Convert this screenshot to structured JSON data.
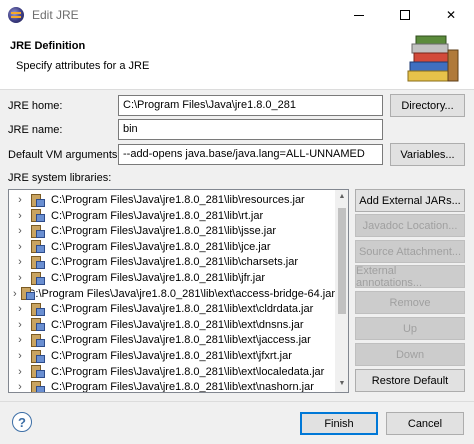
{
  "window": {
    "title": "Edit JRE"
  },
  "banner": {
    "title": "JRE Definition",
    "subtitle": "Specify attributes for a JRE"
  },
  "form": {
    "jre_home_label": "JRE home:",
    "jre_home_value": "C:\\Program Files\\Java\\jre1.8.0_281",
    "directory_button": "Directory...",
    "jre_name_label": "JRE name:",
    "jre_name_value": "bin",
    "vm_args_label": "Default VM arguments:",
    "vm_args_value": "--add-opens java.base/java.lang=ALL-UNNAMED",
    "variables_button": "Variables..."
  },
  "libraries": {
    "label": "JRE system libraries:",
    "items": [
      "C:\\Program Files\\Java\\jre1.8.0_281\\lib\\resources.jar",
      "C:\\Program Files\\Java\\jre1.8.0_281\\lib\\rt.jar",
      "C:\\Program Files\\Java\\jre1.8.0_281\\lib\\jsse.jar",
      "C:\\Program Files\\Java\\jre1.8.0_281\\lib\\jce.jar",
      "C:\\Program Files\\Java\\jre1.8.0_281\\lib\\charsets.jar",
      "C:\\Program Files\\Java\\jre1.8.0_281\\lib\\jfr.jar",
      "C:\\Program Files\\Java\\jre1.8.0_281\\lib\\ext\\access-bridge-64.jar",
      "C:\\Program Files\\Java\\jre1.8.0_281\\lib\\ext\\cldrdata.jar",
      "C:\\Program Files\\Java\\jre1.8.0_281\\lib\\ext\\dnsns.jar",
      "C:\\Program Files\\Java\\jre1.8.0_281\\lib\\ext\\jaccess.jar",
      "C:\\Program Files\\Java\\jre1.8.0_281\\lib\\ext\\jfxrt.jar",
      "C:\\Program Files\\Java\\jre1.8.0_281\\lib\\ext\\localedata.jar",
      "C:\\Program Files\\Java\\jre1.8.0_281\\lib\\ext\\nashorn.jar"
    ],
    "buttons": {
      "add_external": "Add External JARs...",
      "javadoc": "Javadoc Location...",
      "source": "Source Attachment...",
      "external_annotations": "External annotations...",
      "remove": "Remove",
      "up": "Up",
      "down": "Down",
      "restore": "Restore Default"
    }
  },
  "footer": {
    "help_glyph": "?",
    "finish": "Finish",
    "cancel": "Cancel"
  },
  "icons": {
    "app": "eclipse-icon",
    "banner": "books-icon",
    "jar": "jar-library-icon",
    "expand": "chevron-right-icon",
    "help": "help-icon"
  },
  "colors": {
    "default_button_border": "#0078d7",
    "disabled_text": "#a0a0a0"
  }
}
